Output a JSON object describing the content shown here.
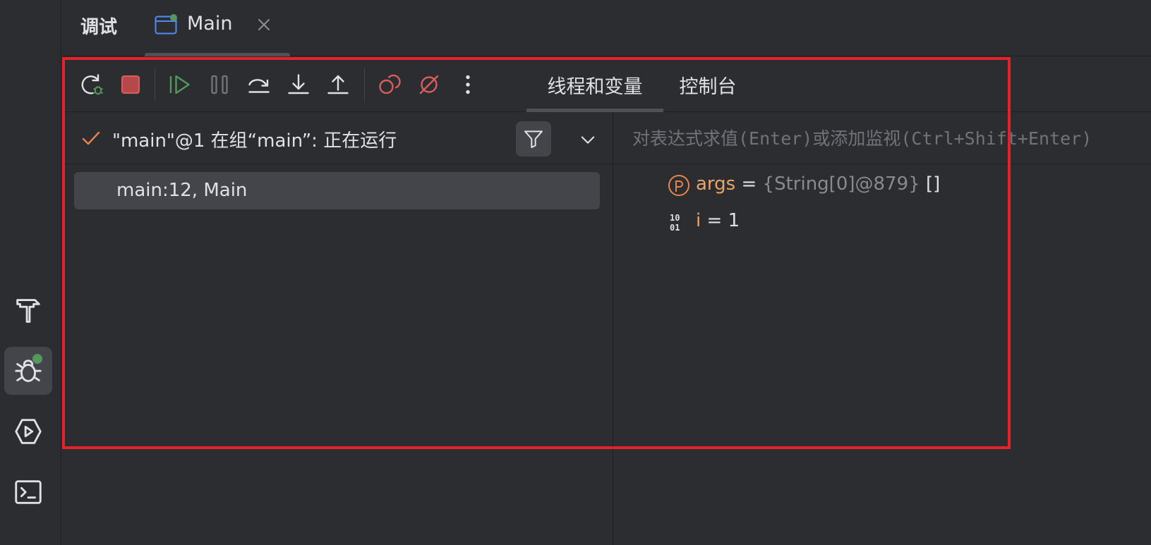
{
  "header": {
    "panel_title": "调试",
    "run_tab_label": "Main"
  },
  "toolbar": {
    "tabs": [
      {
        "label": "线程和变量"
      },
      {
        "label": "控制台"
      }
    ]
  },
  "frames": {
    "thread_label": "\"main\"@1 在组“main”: 正在运行",
    "items": [
      {
        "label": "main:12, Main"
      }
    ]
  },
  "variables": {
    "eval_placeholder": "对表达式求值(Enter)或添加监视(Ctrl+Shift+Enter)",
    "items": [
      {
        "name": "args",
        "eq": " = ",
        "type": "{String[0]@879}",
        "value": " []",
        "icon": "parameter-icon"
      },
      {
        "name": "i",
        "eq": " = ",
        "type": "",
        "value": "1",
        "icon": "primitive-icon"
      }
    ]
  },
  "colors": {
    "highlight": "#e8202a",
    "accent_green": "#57965c",
    "stop_red": "#db5c5c"
  }
}
